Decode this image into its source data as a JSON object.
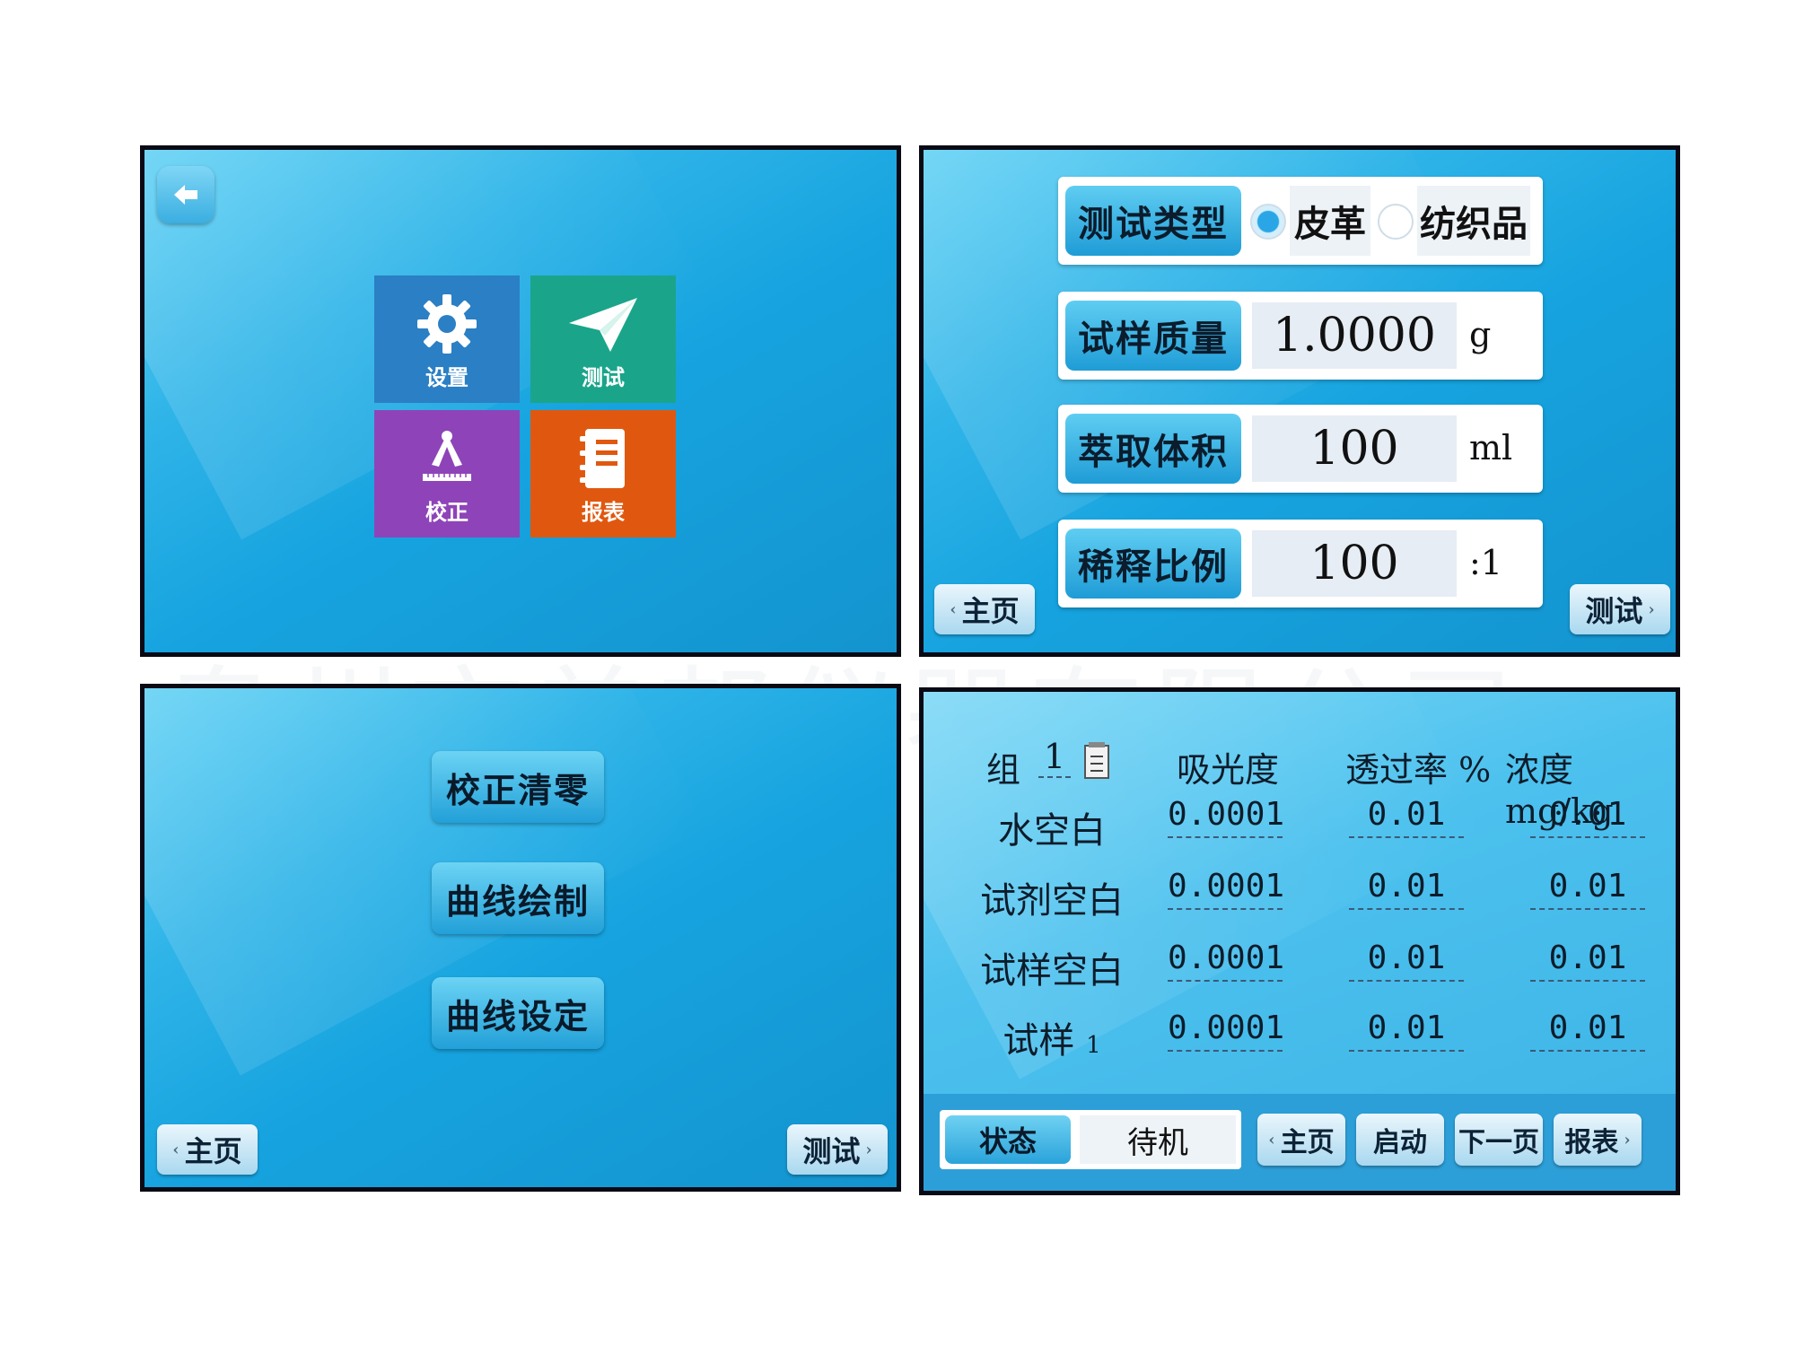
{
  "home": {
    "tiles": [
      {
        "label": "设置",
        "icon": "gear-icon",
        "color": "#2b7fc4"
      },
      {
        "label": "测试",
        "icon": "paper-plane-icon",
        "color": "#1aa58a"
      },
      {
        "label": "校正",
        "icon": "protractor-icon",
        "color": "#8e44b8"
      },
      {
        "label": "报表",
        "icon": "notebook-icon",
        "color": "#e0580f"
      }
    ]
  },
  "params": {
    "test_type": {
      "label": "测试类型",
      "options": [
        "皮革",
        "纺织品"
      ],
      "selected": "皮革"
    },
    "sample_mass": {
      "label": "试样质量",
      "value": "1.0000",
      "unit": "g"
    },
    "extract_volume": {
      "label": "萃取体积",
      "value": "100",
      "unit": "ml"
    },
    "dilution_ratio": {
      "label": "稀释比例",
      "value": "100",
      "unit": ":1"
    },
    "home_btn": "主页",
    "test_btn": "测试"
  },
  "calibration": {
    "buttons": [
      "校正清零",
      "曲线绘制",
      "曲线设定"
    ],
    "home_btn": "主页",
    "test_btn": "测试"
  },
  "results": {
    "group_label": "组",
    "group_value": "1",
    "columns": [
      "吸光度",
      "透过率 %",
      "浓度 mg/kg"
    ],
    "rows": [
      {
        "name": "水空白",
        "values": [
          "0.0001",
          "0.01",
          "0.01"
        ]
      },
      {
        "name": "试剂空白",
        "values": [
          "0.0001",
          "0.01",
          "0.01"
        ]
      },
      {
        "name": "试样空白",
        "values": [
          "0.0001",
          "0.01",
          "0.01"
        ]
      },
      {
        "name": "试样",
        "suffix": "1",
        "values": [
          "0.0001",
          "0.01",
          "0.01"
        ]
      }
    ],
    "status_label": "状态",
    "status_value": "待机",
    "buttons": [
      "主页",
      "启动",
      "下一页",
      "报表"
    ]
  },
  "watermark": "泉州市美邦仪器有限公司"
}
